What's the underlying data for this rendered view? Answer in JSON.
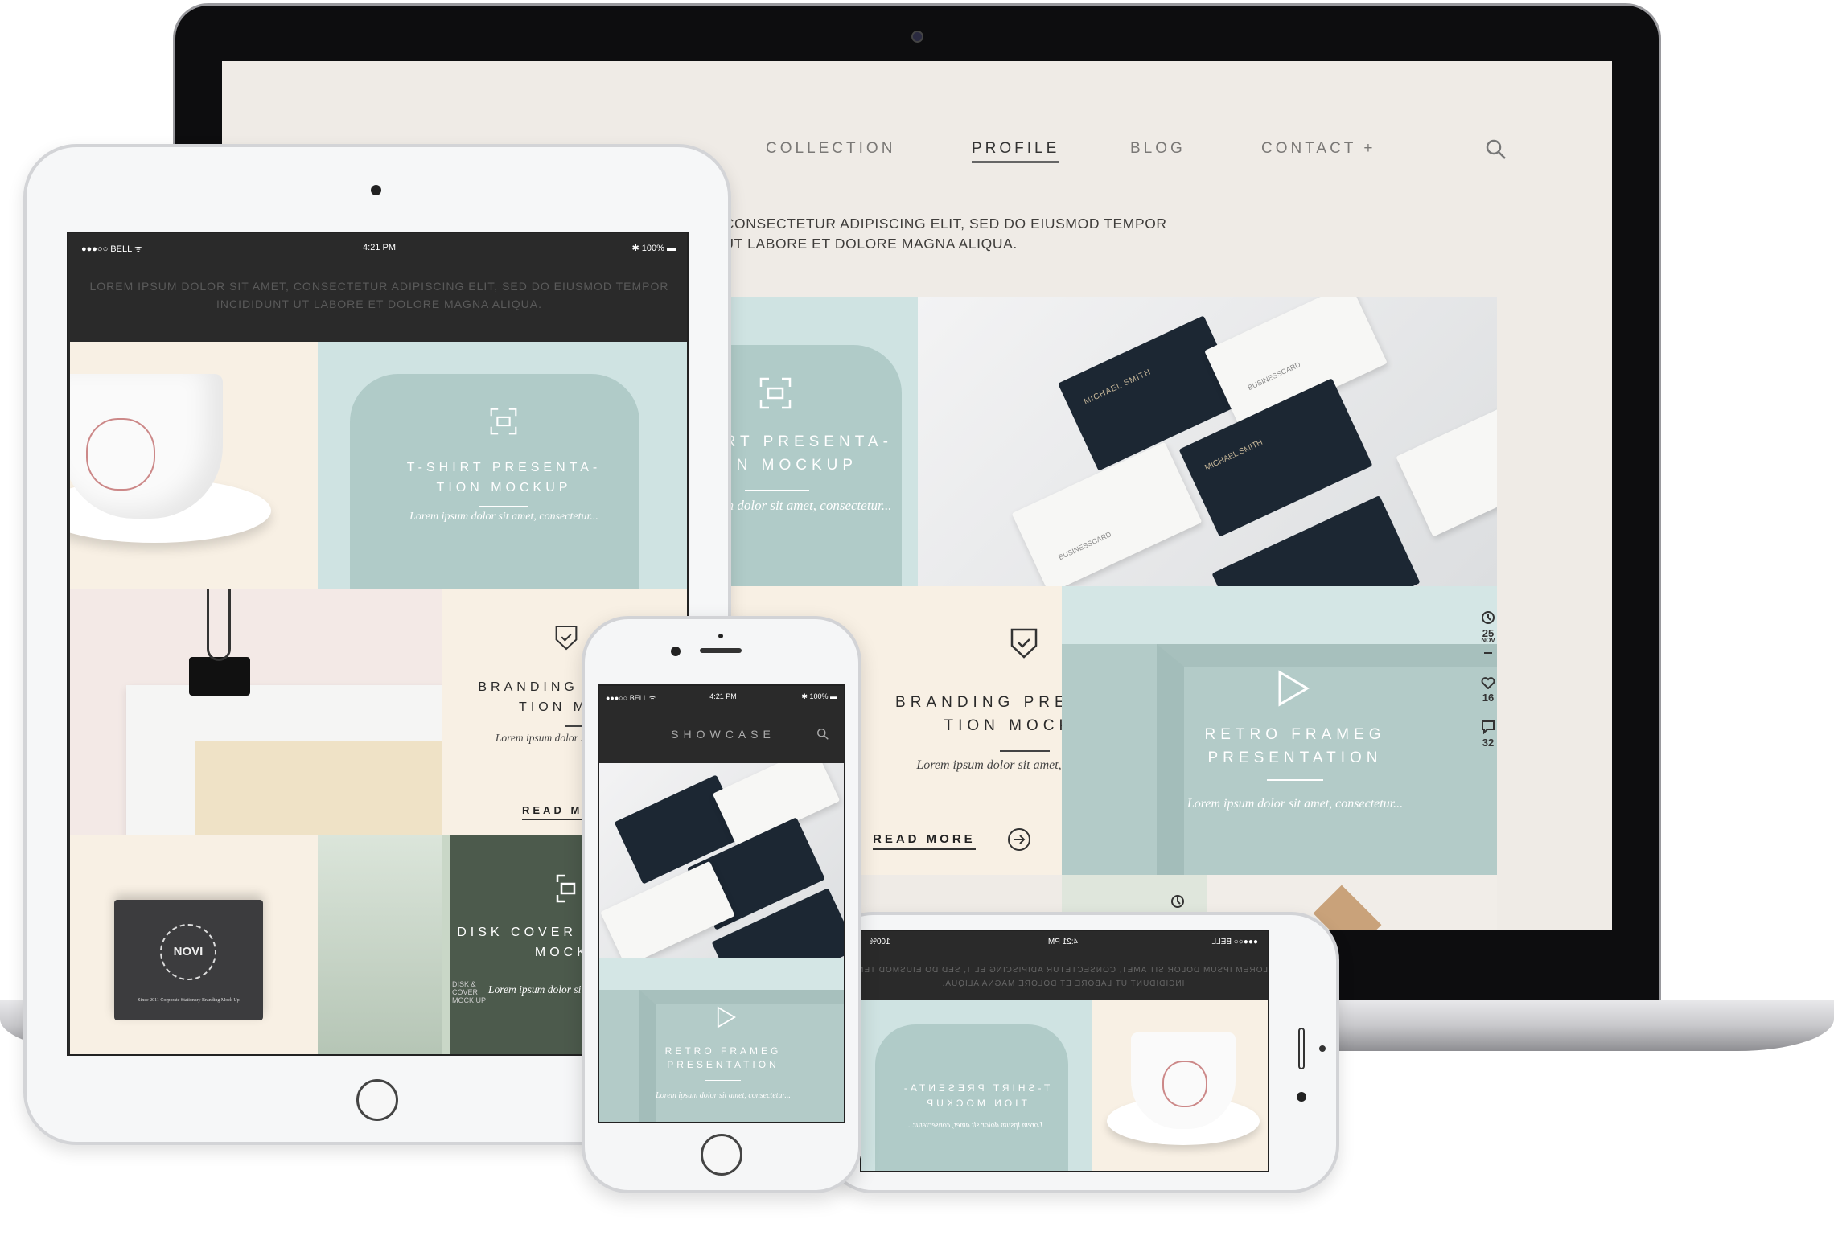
{
  "laptop": {
    "nav": [
      {
        "label": "COLLECTION",
        "active": false
      },
      {
        "label": "PROFILE",
        "active": true
      },
      {
        "label": "BLOG",
        "active": false
      },
      {
        "label": "CONTACT +",
        "active": false
      }
    ],
    "intro_line1": "LOREM IPSUM DOLOR SIT AMET, CONSECTETUR ADIPISCING ELIT, SED DO EIUSMOD TEMPOR",
    "intro_line2": "INCIDIDUNT UT LABORE ET DOLORE MAGNA ALIQUA.",
    "tshirt": {
      "title1": "T-SHIRT PRESENTA-",
      "title2": "TION MOCKUP",
      "text": "Lorem ipsum dolor sit amet, consectetur..."
    },
    "branding": {
      "title1": "BRANDING PRESENTA-",
      "title2": "TION MOCKUP",
      "text": "Lorem ipsum dolor sit amet, consectetur...",
      "read_more": "READ MORE"
    },
    "frame": {
      "title1": "RETRO FRAMEG",
      "title2": "PRESENTATION",
      "text": "Lorem ipsum dolor sit amet, consectetur..."
    },
    "meta": {
      "day": "25",
      "month": "NOV",
      "likes": "16",
      "comments": "32"
    },
    "cards": {
      "name": "MICHAEL SMITH",
      "brand": "BUSINESSCARD"
    }
  },
  "status_bar": {
    "carrier": "BELL",
    "time": "4:21 PM",
    "battery": "100%"
  },
  "tablet": {
    "intro_line1": "LOREM IPSUM DOLOR SIT AMET, CONSECTETUR ADIPISCING ELIT, SED DO EIUSMOD TEMPOR",
    "intro_line2": "INCIDIDUNT UT LABORE ET DOLORE MAGNA ALIQUA.",
    "tshirt": {
      "title1": "T-SHIRT PRESENTA-",
      "title2": "TION MOCKUP",
      "text": "Lorem ipsum dolor sit amet, consectetur..."
    },
    "branding": {
      "title1": "BRANDING PRESENTA-",
      "title2": "TION MOCKUP",
      "text": "Lorem ipsum dolor sit amet, consectetur...",
      "read_more": "READ MORE"
    },
    "disk": {
      "title1": "DISK COVER PRESENTA-",
      "title2": "MOCKUP",
      "text": "Lorem ipsum dolor sit amet, consectetur...",
      "badge": "DISK & COVER MOCK UP"
    },
    "notebook": {
      "logo": "NOVI",
      "caption": "Since 2011 Corporate Stationary Branding Mock Up"
    }
  },
  "phone": {
    "title": "SHOWCASE",
    "frame": {
      "title1": "RETRO FRAMEG",
      "title2": "PRESENTATION",
      "text": "Lorem ipsum dolor sit amet, consectetur..."
    }
  },
  "phone_landscape": {
    "intro_line1": "LOREM IPSUM DOLOR SIT AMET, CONSECTETUR ADIPISCING ELIT, SED DO EIUSMOD TEMPOR",
    "intro_line2": "INCIDIDUNT UT LABORE ET DOLORE MAGNA ALIQUA.",
    "tshirt": {
      "title1": "T-SHIRT PRESENTA-",
      "title2": "TION MOCKUP",
      "text": "Lorem ipsum dolor sit amet, consectetur..."
    }
  },
  "colors": {
    "cream": "#f8f0e4",
    "mint": "#cfe3e2",
    "sage": "#b3cbc8",
    "dark": "#2a2a2a",
    "forest": "#4c5a4c"
  }
}
